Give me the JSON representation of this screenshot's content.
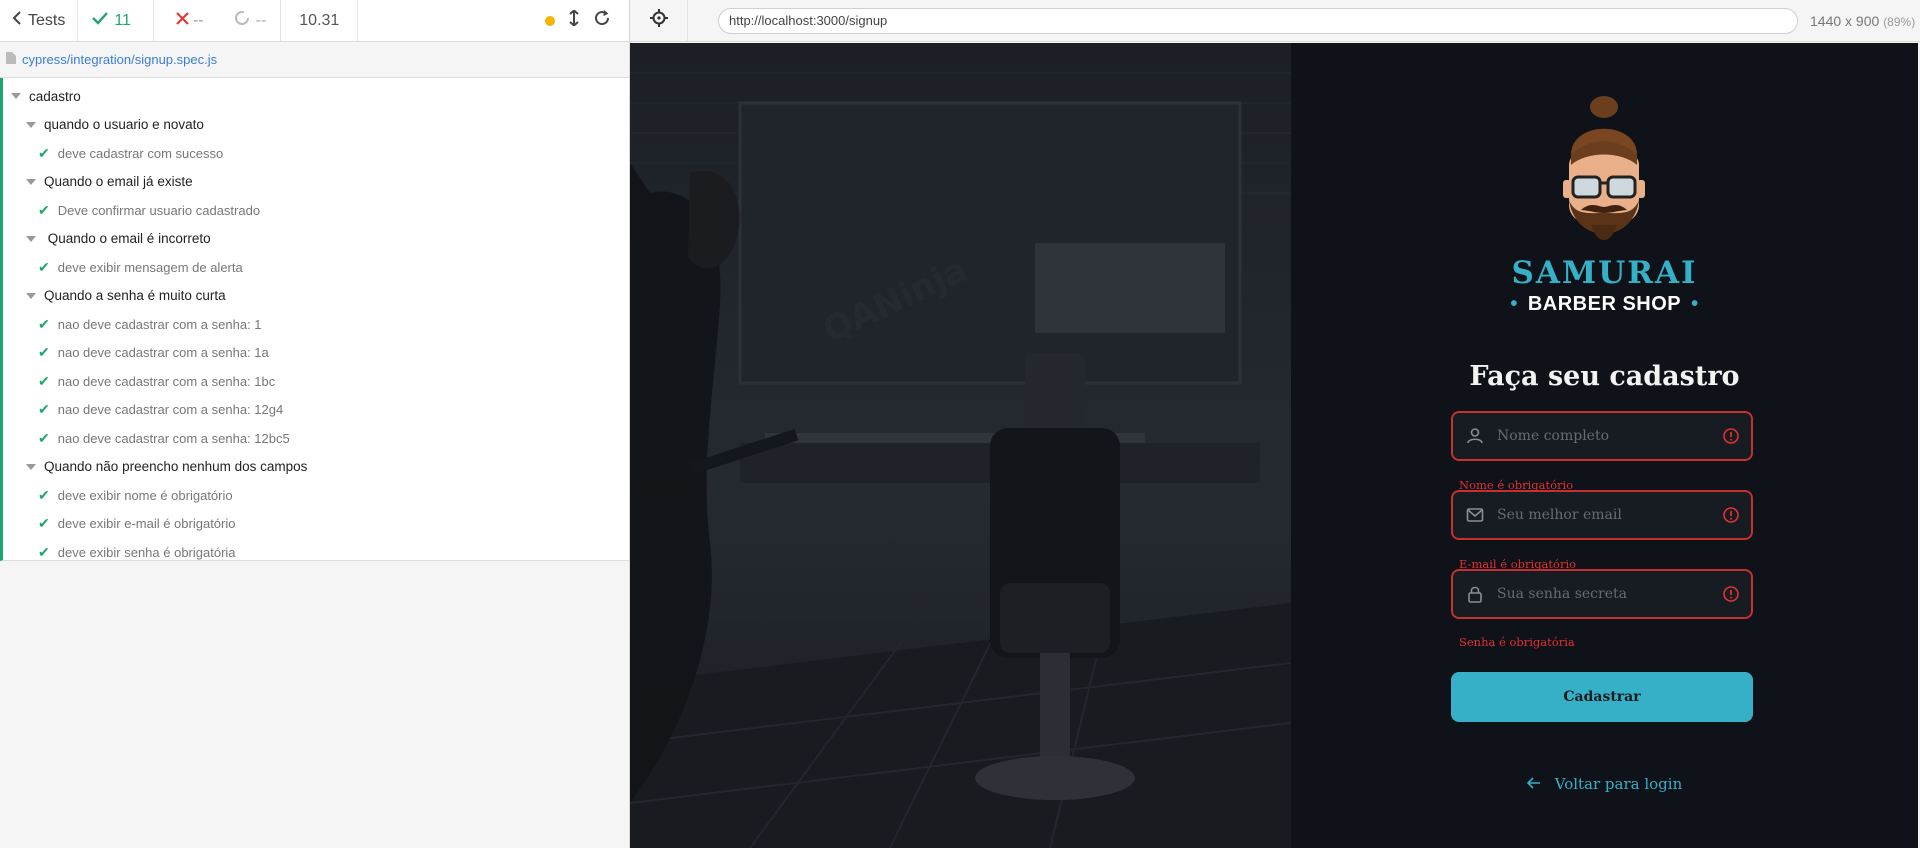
{
  "runner": {
    "back_label": "Tests",
    "passed": "11",
    "failed": "--",
    "pending": "--",
    "duration": "10.31",
    "spec_file": "cypress/integration/signup.spec.js"
  },
  "tree": [
    {
      "kind": "suite",
      "indent": 0,
      "label": "cadastro"
    },
    {
      "kind": "suite",
      "indent": 1,
      "label": "quando o usuario e novato"
    },
    {
      "kind": "test",
      "indent": 2,
      "label": "deve cadastrar com sucesso"
    },
    {
      "kind": "suite",
      "indent": 1,
      "label": "Quando o email já existe"
    },
    {
      "kind": "test",
      "indent": 2,
      "label": "Deve confirmar usuario cadastrado"
    },
    {
      "kind": "suite",
      "indent": 1,
      "label": " Quando o email é incorreto"
    },
    {
      "kind": "test",
      "indent": 2,
      "label": "deve exibir mensagem de alerta"
    },
    {
      "kind": "suite",
      "indent": 1,
      "label": "Quando a senha é muito curta"
    },
    {
      "kind": "test",
      "indent": 2,
      "label": "nao deve cadastrar com a senha: 1"
    },
    {
      "kind": "test",
      "indent": 2,
      "label": "nao deve cadastrar com a senha: 1a"
    },
    {
      "kind": "test",
      "indent": 2,
      "label": "nao deve cadastrar com a senha: 1bc"
    },
    {
      "kind": "test",
      "indent": 2,
      "label": "nao deve cadastrar com a senha: 12g4"
    },
    {
      "kind": "test",
      "indent": 2,
      "label": "nao deve cadastrar com a senha: 12bc5"
    },
    {
      "kind": "suite",
      "indent": 1,
      "label": "Quando não preencho nenhum dos campos"
    },
    {
      "kind": "test",
      "indent": 2,
      "label": "deve exibir nome é obrigatório"
    },
    {
      "kind": "test",
      "indent": 2,
      "label": "deve exibir e-mail é obrigatório"
    },
    {
      "kind": "test",
      "indent": 2,
      "label": "deve exibir senha é obrigatória"
    }
  ],
  "browser": {
    "url": "http://localhost:3000/signup",
    "viewport": "1440 x 900",
    "zoom": "(89%)"
  },
  "app": {
    "brand_title": "SAMURAI",
    "brand_subtitle": "BARBER SHOP",
    "form_title": "Faça seu cadastro",
    "fields": {
      "name": {
        "placeholder": "Nome completo",
        "error": "Nome é obrigatório"
      },
      "email": {
        "placeholder": "Seu melhor email",
        "error": "E-mail é obrigatório"
      },
      "password": {
        "placeholder": "Sua senha secreta",
        "error": "Senha é obrigatória"
      }
    },
    "submit_label": "Cadastrar",
    "back_label": "Voltar para login",
    "accent_color": "#35b0c6",
    "error_color": "#c53030"
  }
}
